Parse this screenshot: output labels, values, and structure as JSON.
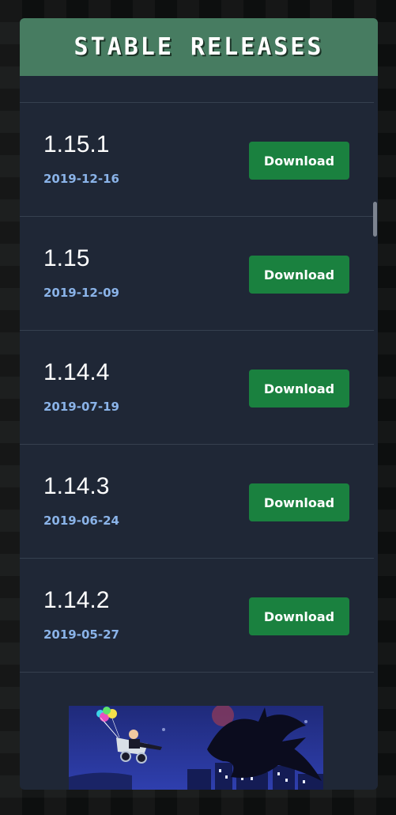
{
  "panel": {
    "title": "Stable Releases"
  },
  "releases": [
    {
      "version": "1.15.1",
      "date": "2019-12-16",
      "button_label": "Download"
    },
    {
      "version": "1.15",
      "date": "2019-12-09",
      "button_label": "Download"
    },
    {
      "version": "1.14.4",
      "date": "2019-07-19",
      "button_label": "Download"
    },
    {
      "version": "1.14.3",
      "date": "2019-06-24",
      "button_label": "Download"
    },
    {
      "version": "1.14.2",
      "date": "2019-05-27",
      "button_label": "Download"
    }
  ],
  "colors": {
    "header_bg": "#477c61",
    "panel_bg": "#1f2736",
    "button_bg": "#1a813f",
    "date_text": "#8ab3e8"
  }
}
